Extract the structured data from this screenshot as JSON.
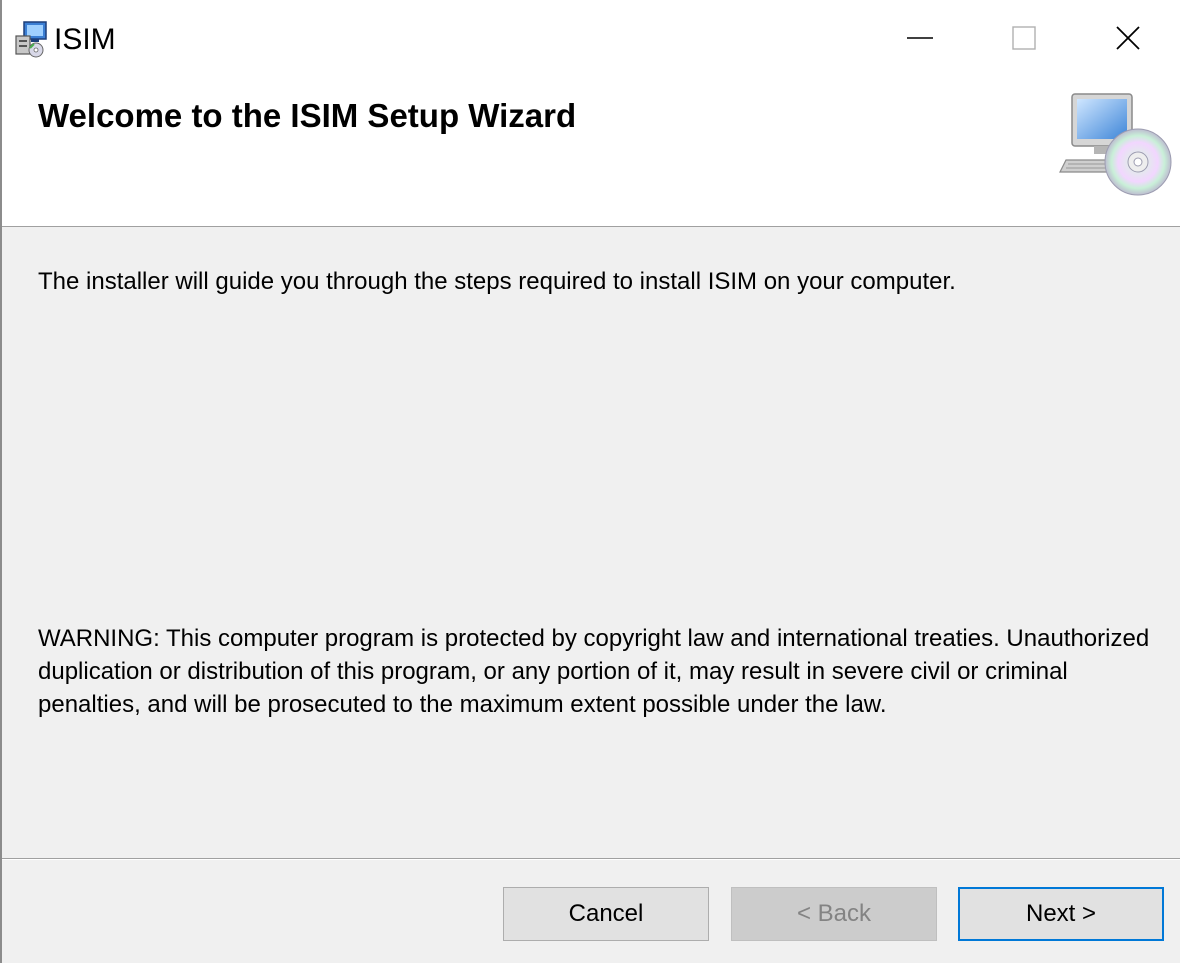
{
  "window": {
    "title": "ISIM",
    "controls": {
      "minimize": "minimize",
      "maximize": "maximize",
      "close": "close"
    }
  },
  "banner": {
    "title": "Welcome to the ISIM Setup Wizard",
    "icon": "computer-cd-icon"
  },
  "body": {
    "intro": "The installer will guide you through the steps required to install ISIM on your computer.",
    "warning": "WARNING: This computer program is protected by copyright law and international treaties. Unauthorized duplication or distribution of this program, or any portion of it, may result in severe civil or criminal penalties, and will be prosecuted to the maximum extent possible under the law."
  },
  "buttons": {
    "cancel": "Cancel",
    "back": "< Back",
    "next": "Next >",
    "back_enabled": false,
    "default": "next"
  },
  "colors": {
    "accent": "#0078d7",
    "dialog_background": "#f0f0f0",
    "disabled_text": "#838383"
  }
}
